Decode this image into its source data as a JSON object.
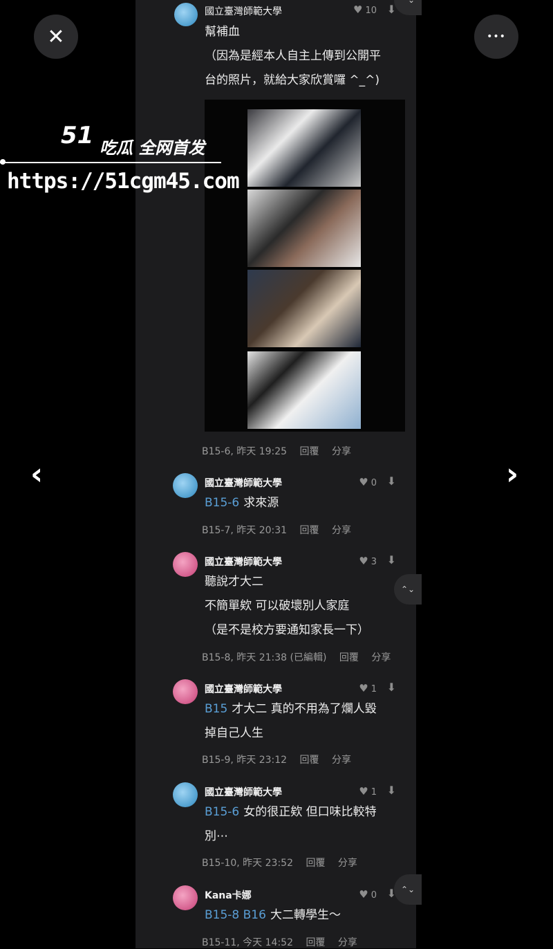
{
  "top_bar": {
    "close_icon": "close-icon",
    "more_icon": "more-icon",
    "close_glyph": "✕",
    "more_glyph": "•••"
  },
  "nav": {
    "prev_glyph": "‹",
    "next_glyph": "›"
  },
  "watermark": {
    "brand": "51",
    "tagline": "吃瓜 全网首发",
    "url": "https://51cgm45.com"
  },
  "post_top": {
    "author": "國立臺灣師範大學",
    "likes": "10",
    "lines": [
      "幫補血",
      "（因為是經本人自主上傳到公開平",
      "台的照片，就給大家欣賞囉 ^_^)"
    ],
    "meta": {
      "floor": "B15-6, 昨天 19:25",
      "reply": "回覆",
      "share": "分享"
    }
  },
  "comments": [
    {
      "author": "國立臺灣師範大學",
      "likes": "0",
      "avatar": "blue",
      "ref": "B15-6",
      "lines": [
        "求來源"
      ],
      "meta": {
        "floor": "B15-7, 昨天 20:31",
        "reply": "回覆",
        "share": "分享"
      }
    },
    {
      "author": "國立臺灣師範大學",
      "likes": "3",
      "avatar": "pink",
      "ref": "",
      "lines": [
        "聽說才大二",
        "不簡單欸 可以破壞別人家庭",
        "（是不是校方要通知家長一下）"
      ],
      "meta": {
        "floor": "B15-8, 昨天 21:38 (已編輯)",
        "reply": "回覆",
        "share": "分享"
      }
    },
    {
      "author": "國立臺灣師範大學",
      "likes": "1",
      "avatar": "pink",
      "ref": "B15",
      "lines": [
        "才大二 真的不用為了爛人毀",
        "掉自己人生"
      ],
      "meta": {
        "floor": "B15-9, 昨天 23:12",
        "reply": "回覆",
        "share": "分享"
      }
    },
    {
      "author": "國立臺灣師範大學",
      "likes": "1",
      "avatar": "blue",
      "ref": "B15-6",
      "lines": [
        "女的很正欸 但口味比較特",
        "別⋯"
      ],
      "meta": {
        "floor": "B15-10, 昨天 23:52",
        "reply": "回覆",
        "share": "分享"
      }
    },
    {
      "author": "Kana卡娜",
      "likes": "0",
      "avatar": "pink",
      "ref": "B15-8 B16",
      "lines": [
        "大二轉學生～"
      ],
      "meta": {
        "floor": "B15-11, 今天 14:52",
        "reply": "回覆",
        "share": "分享"
      }
    }
  ],
  "scroll_glyph": "⌃⌄"
}
